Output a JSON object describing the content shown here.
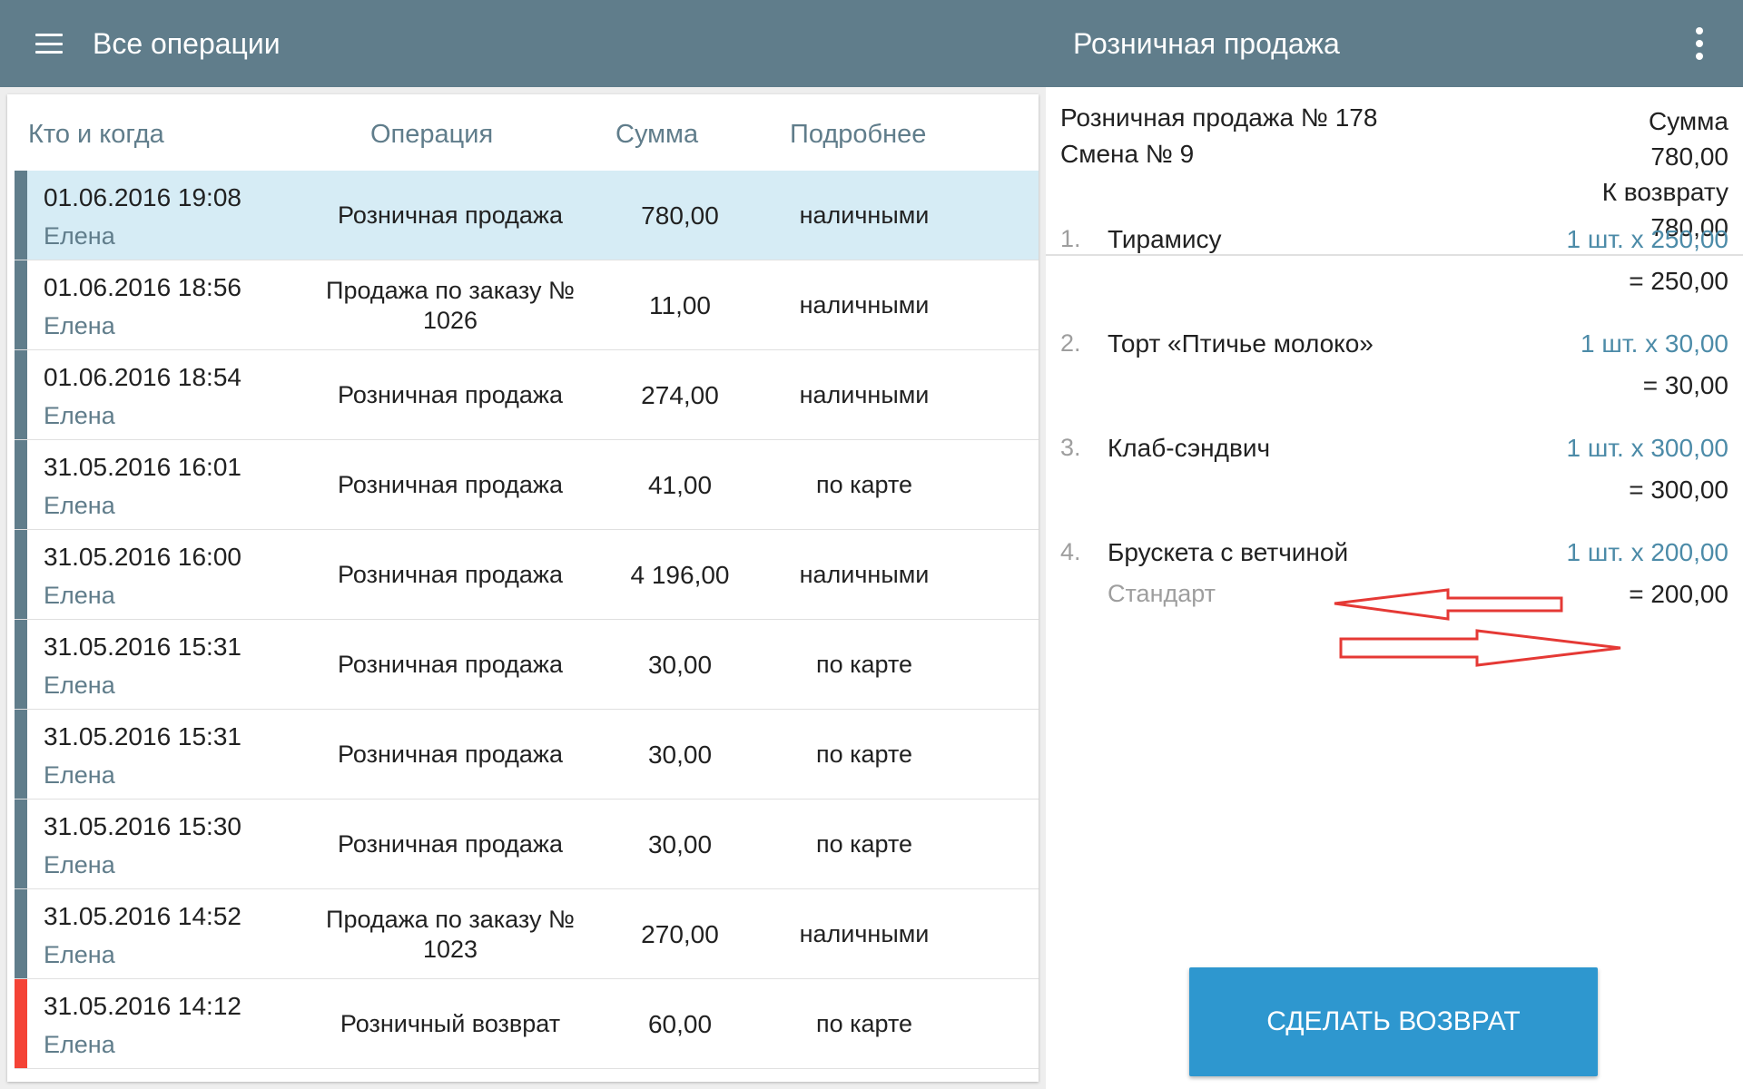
{
  "appbar": {
    "title": "Все операции",
    "detail_title": "Розничная продажа"
  },
  "list": {
    "headers": {
      "who": "Кто и когда",
      "operation": "Операция",
      "sum": "Сумма",
      "more": "Подробнее"
    },
    "rows": [
      {
        "date": "01.06.2016 19:08",
        "who": "Елена",
        "operation": "Розничная продажа",
        "sum": "780,00",
        "payment": "наличными",
        "type": "sale",
        "selected": true
      },
      {
        "date": "01.06.2016 18:56",
        "who": "Елена",
        "operation": "Продажа по заказу № 1026",
        "sum": "11,00",
        "payment": "наличными",
        "type": "sale",
        "selected": false
      },
      {
        "date": "01.06.2016 18:54",
        "who": "Елена",
        "operation": "Розничная продажа",
        "sum": "274,00",
        "payment": "наличными",
        "type": "sale",
        "selected": false
      },
      {
        "date": "31.05.2016 16:01",
        "who": "Елена",
        "operation": "Розничная продажа",
        "sum": "41,00",
        "payment": "по карте",
        "type": "sale",
        "selected": false
      },
      {
        "date": "31.05.2016 16:00",
        "who": "Елена",
        "operation": "Розничная продажа",
        "sum": "4 196,00",
        "payment": "наличными",
        "type": "sale",
        "selected": false
      },
      {
        "date": "31.05.2016 15:31",
        "who": "Елена",
        "operation": "Розничная продажа",
        "sum": "30,00",
        "payment": "по карте",
        "type": "sale",
        "selected": false
      },
      {
        "date": "31.05.2016 15:31",
        "who": "Елена",
        "operation": "Розничная продажа",
        "sum": "30,00",
        "payment": "по карте",
        "type": "sale",
        "selected": false
      },
      {
        "date": "31.05.2016 15:30",
        "who": "Елена",
        "operation": "Розничная продажа",
        "sum": "30,00",
        "payment": "по карте",
        "type": "sale",
        "selected": false
      },
      {
        "date": "31.05.2016 14:52",
        "who": "Елена",
        "operation": "Продажа по заказу № 1023",
        "sum": "270,00",
        "payment": "наличными",
        "type": "sale",
        "selected": false
      },
      {
        "date": "31.05.2016 14:12",
        "who": "Елена",
        "operation": "Розничный возврат",
        "sum": "60,00",
        "payment": "по карте",
        "type": "return",
        "selected": false
      }
    ]
  },
  "detail": {
    "name": "Розничная продажа № 178",
    "shift": "Смена № 9",
    "sum_label": "Сумма",
    "sum_value": "780,00",
    "refund_label": "К возврату",
    "refund_value": "780,00",
    "items": [
      {
        "num": "1.",
        "name": "Тирамису",
        "modifier": "",
        "qty": "1 шт. x 250,00",
        "total": "= 250,00"
      },
      {
        "num": "2.",
        "name": "Торт «Птичье молоко»",
        "modifier": "",
        "qty": "1 шт. x 30,00",
        "total": "= 30,00"
      },
      {
        "num": "3.",
        "name": "Клаб-сэндвич",
        "modifier": "",
        "qty": "1 шт. x 300,00",
        "total": "= 300,00"
      },
      {
        "num": "4.",
        "name": "Брускета с ветчиной",
        "modifier": "Стандарт",
        "qty": "1 шт. x 200,00",
        "total": "= 200,00"
      }
    ],
    "refund_button": "СДЕЛАТЬ ВОЗВРАТ"
  },
  "colors": {
    "appbar": "#607d8b",
    "row_bar_sale": "#607d8b",
    "row_bar_return": "#f44336",
    "selected_row": "#d6ecf5",
    "accent_button": "#2e97cf",
    "annotation_arrows": "#e53935"
  },
  "icons": {
    "menu": "menu-icon",
    "overflow": "more-vert-icon",
    "annotation": "red-arrow-icon"
  }
}
